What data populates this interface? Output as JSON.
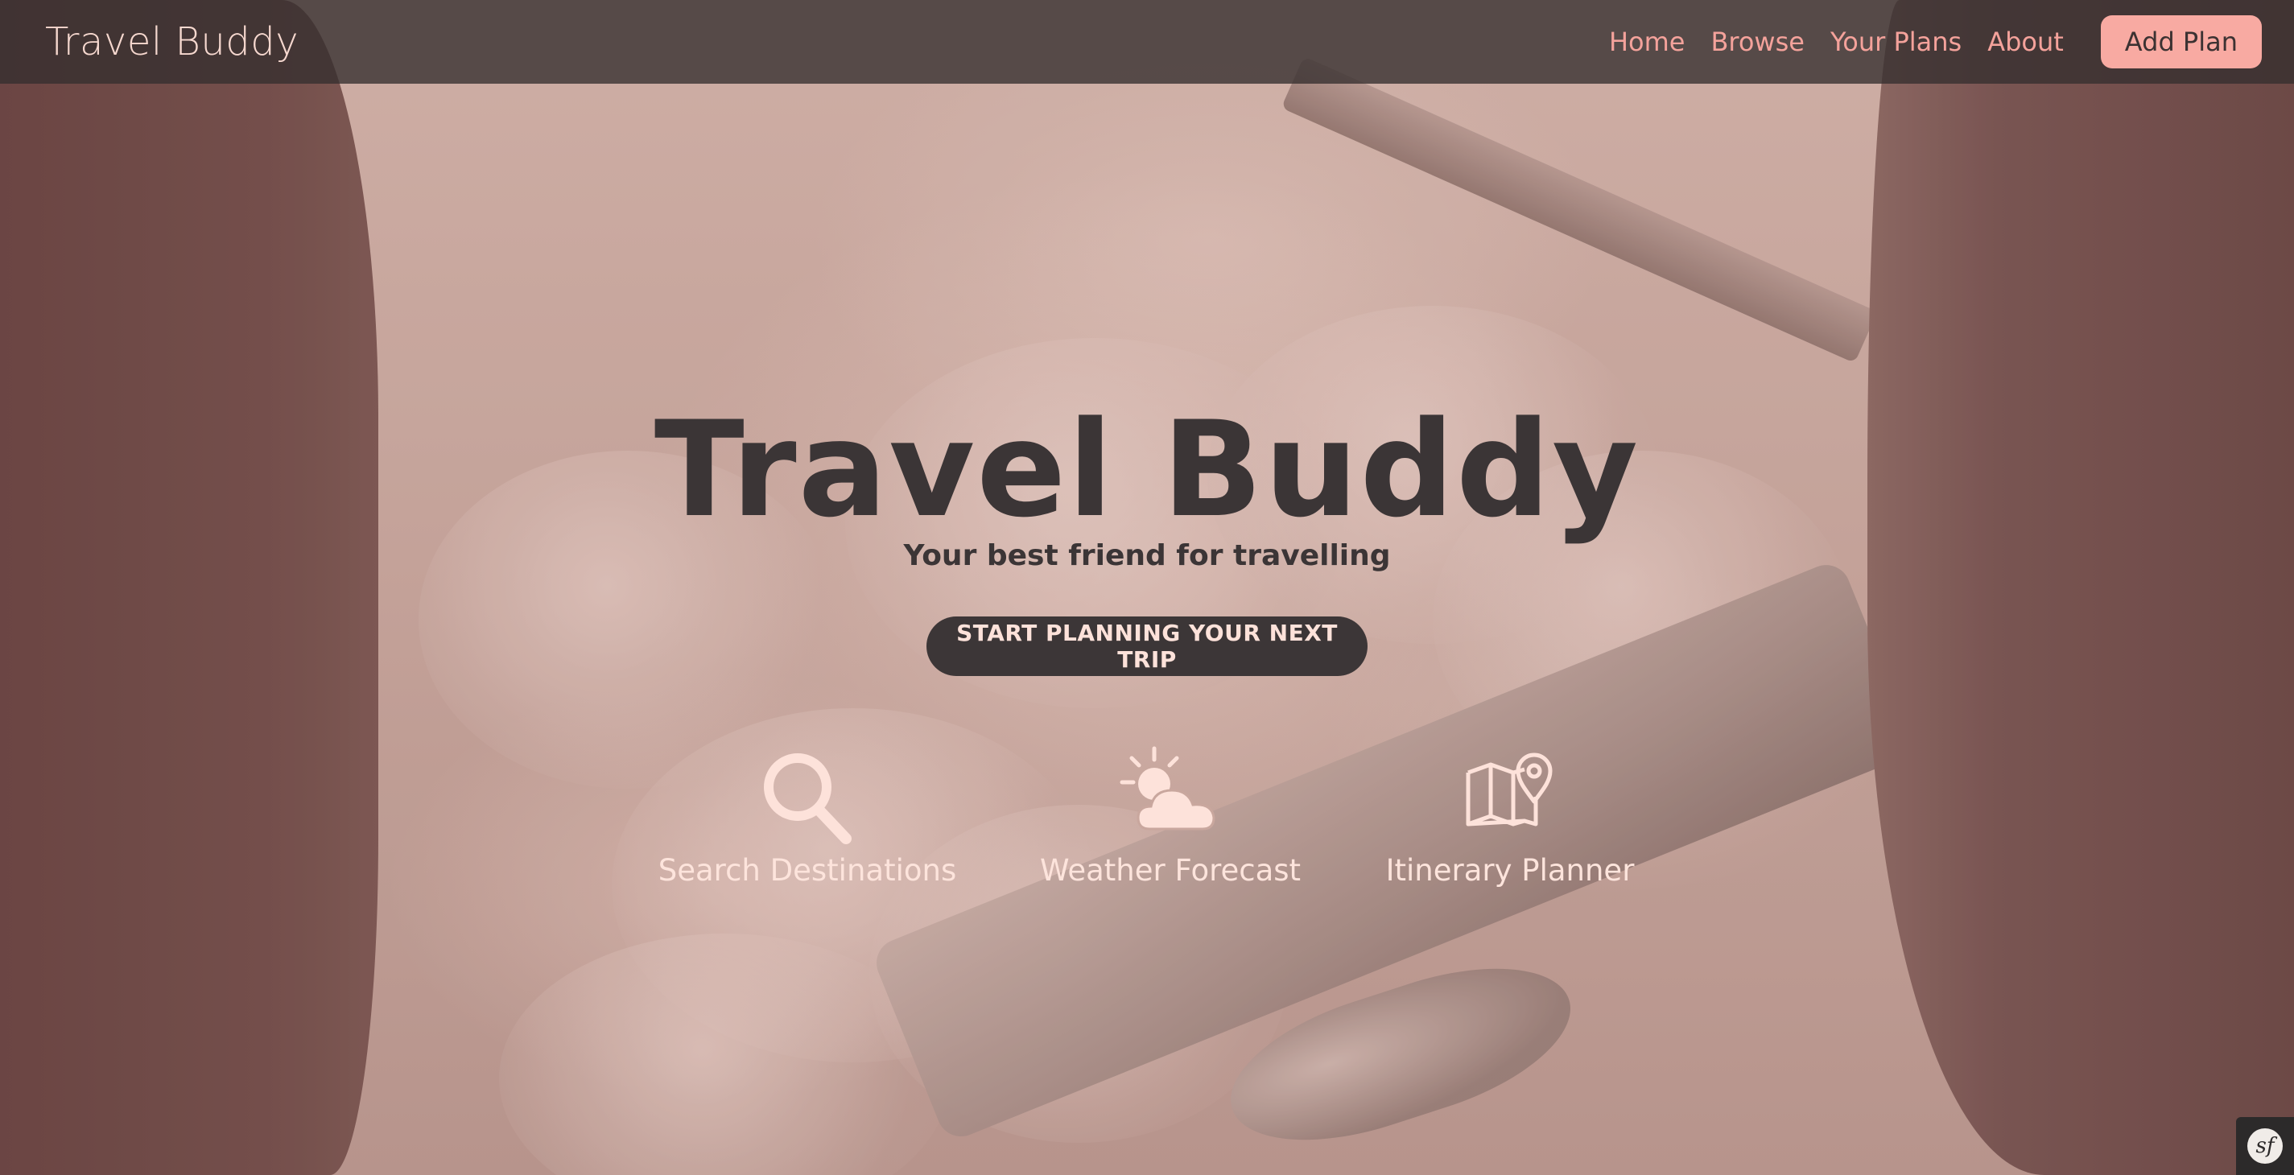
{
  "navbar": {
    "brand": "Travel Buddy",
    "links": [
      {
        "label": "Home"
      },
      {
        "label": "Browse"
      },
      {
        "label": "Your Plans"
      },
      {
        "label": "About"
      }
    ],
    "add_plan_label": "Add Plan"
  },
  "hero": {
    "title": "Travel Buddy",
    "subtitle": "Your best friend for travelling",
    "cta_label": "START PLANNING YOUR NEXT TRIP"
  },
  "features": [
    {
      "label": "Search Destinations",
      "icon": "search-icon"
    },
    {
      "label": "Weather Forecast",
      "icon": "partly-cloudy-icon"
    },
    {
      "label": "Itinerary Planner",
      "icon": "map-pin-icon"
    }
  ],
  "corner_badge": {
    "icon": "symfony-icon",
    "glyph": "sf"
  },
  "colors": {
    "nav_background": "#342e2e",
    "nav_link": "#f4a29b",
    "add_plan_background": "#f8aaa2",
    "hero_text": "#3b3536",
    "cta_background": "#3c3637",
    "feature_text": "#fde4dc"
  }
}
